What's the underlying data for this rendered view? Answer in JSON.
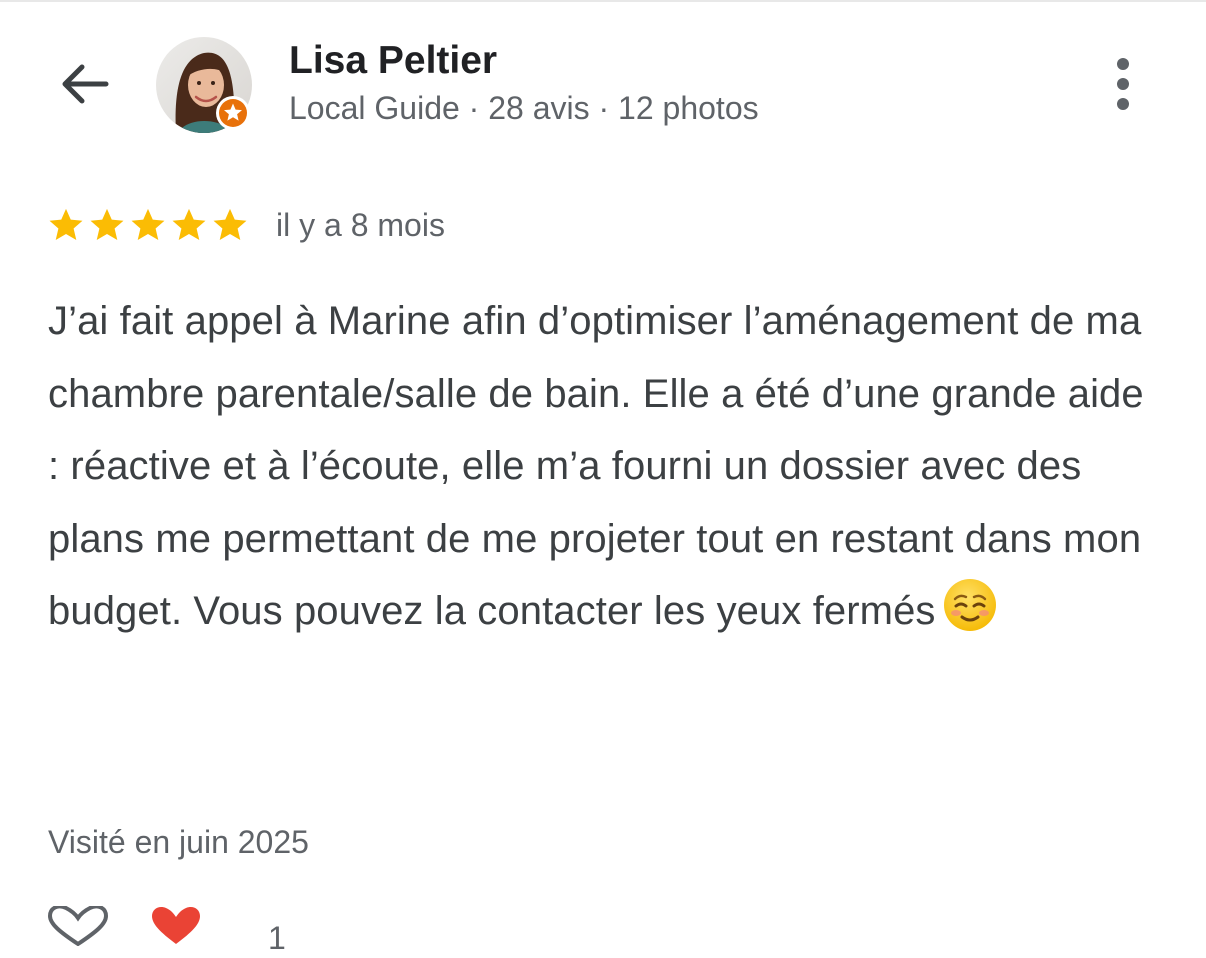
{
  "header": {
    "reviewer_name": "Lisa Peltier",
    "reviewer_meta": "Local Guide · 28 avis · 12 photos",
    "back_icon": "arrow-left-icon",
    "more_icon": "more-vert-icon"
  },
  "review": {
    "rating": 5,
    "rating_max": 5,
    "time_ago": "il y a 8 mois",
    "text": "J’ai fait appel à Marine afin d’optimiser l’aménagement de ma chambre parentale/salle de bain. Elle a été d’une grande aide : réactive et à l’écoute, elle m’a fourni un dossier avec des plans me permettant de me projeter tout en restant dans mon budget. Vous pouvez la contacter les yeux fermés",
    "emoji": "smiling-face-emoji",
    "visited": "Visité en juin 2025"
  },
  "reactions": {
    "like_icon": "heart-outline-icon",
    "heart_icon": "heart-filled-icon",
    "count": "1"
  },
  "colors": {
    "star": "#fbbc04",
    "guide_badge": "#e8710a",
    "heart": "#ea4335",
    "secondary_text": "#5f6368",
    "primary_text": "#202124"
  }
}
